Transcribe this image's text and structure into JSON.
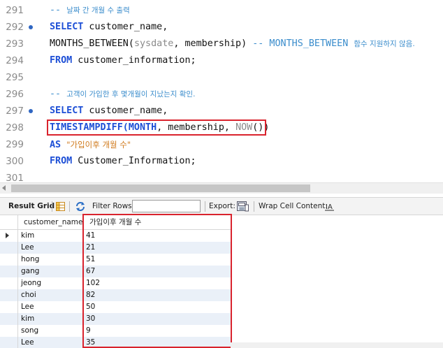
{
  "editor": {
    "lines": [
      {
        "num": "291",
        "dot": false,
        "parts": [
          {
            "t": "-- ",
            "c": "cm"
          },
          {
            "t": "날짜 간 개월 수 출력",
            "c": "cm cm-ko"
          }
        ]
      },
      {
        "num": "292",
        "dot": true,
        "parts": [
          {
            "t": "SELECT",
            "c": "kw"
          },
          {
            "t": " customer_name,",
            "c": ""
          }
        ]
      },
      {
        "num": "293",
        "dot": false,
        "parts": [
          {
            "t": "MONTHS_BETWEEN(",
            "c": ""
          },
          {
            "t": "sysdate",
            "c": "gray"
          },
          {
            "t": ", membership) ",
            "c": ""
          },
          {
            "t": "-- MONTHS_BETWEEN ",
            "c": "cm"
          },
          {
            "t": "함수 지원하지 않음.",
            "c": "cm cm-ko"
          }
        ]
      },
      {
        "num": "294",
        "dot": false,
        "parts": [
          {
            "t": "FROM",
            "c": "kw"
          },
          {
            "t": " customer_information;",
            "c": ""
          }
        ]
      },
      {
        "num": "295",
        "dot": false,
        "parts": []
      },
      {
        "num": "296",
        "dot": false,
        "parts": [
          {
            "t": "-- ",
            "c": "cm"
          },
          {
            "t": "고객이 가입한 후 몇개월이 지났는지 확인.",
            "c": "cm cm-ko"
          }
        ]
      },
      {
        "num": "297",
        "dot": true,
        "parts": [
          {
            "t": "SELECT",
            "c": "kw"
          },
          {
            "t": " customer_name,",
            "c": ""
          }
        ]
      },
      {
        "num": "298",
        "dot": false,
        "parts": [
          {
            "t": "TIMESTAMPDIFF(",
            "c": "kw"
          },
          {
            "t": "MONTH",
            "c": "kw"
          },
          {
            "t": ", membership, ",
            "c": ""
          },
          {
            "t": "NOW",
            "c": "gray"
          },
          {
            "t": "())",
            "c": ""
          }
        ]
      },
      {
        "num": "299",
        "dot": false,
        "parts": [
          {
            "t": "AS",
            "c": "kw"
          },
          {
            "t": " ",
            "c": ""
          },
          {
            "t": "\"가입이후 개월 수\"",
            "c": "st st-ko"
          }
        ]
      },
      {
        "num": "300",
        "dot": false,
        "parts": [
          {
            "t": "FROM",
            "c": "kw"
          },
          {
            "t": " Customer_Information;",
            "c": ""
          }
        ]
      },
      {
        "num": "301",
        "dot": false,
        "parts": []
      }
    ]
  },
  "toolbar": {
    "result_grid": "Result Grid",
    "filter_rows": "Filter Rows:",
    "filter_value": "",
    "export": "Export:",
    "wrap": "Wrap Cell Content:",
    "icons": [
      "grid-view-icon",
      "refresh-icon",
      "export-file-icon",
      "wrap-text-icon"
    ]
  },
  "grid": {
    "columns": [
      "customer_name",
      "가입이후 개월 수"
    ],
    "rows": [
      [
        "kim",
        "41"
      ],
      [
        "Lee",
        "21"
      ],
      [
        "hong",
        "51"
      ],
      [
        "gang",
        "67"
      ],
      [
        "jeong",
        "102"
      ],
      [
        "choi",
        "82"
      ],
      [
        "Lee",
        "50"
      ],
      [
        "kim",
        "30"
      ],
      [
        "song",
        "9"
      ],
      [
        "Lee",
        "35"
      ]
    ]
  },
  "colors": {
    "keyword": "#1d4fd6",
    "comment": "#3b8dcc",
    "string": "#d07a1c",
    "highlight_box": "#d9232d",
    "alt_row": "#eaf0f8"
  }
}
